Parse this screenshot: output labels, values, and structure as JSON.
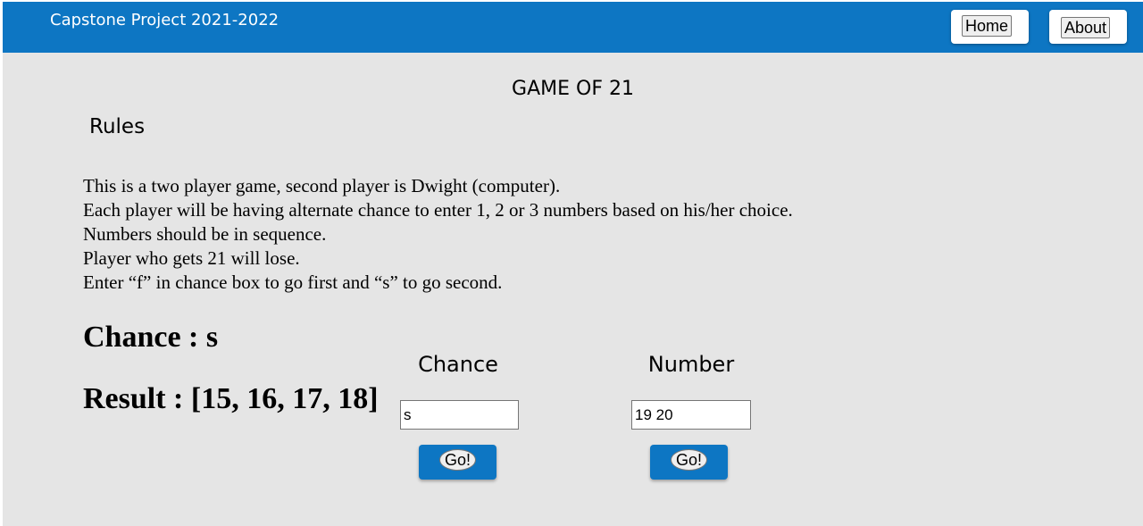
{
  "navbar": {
    "brand": "Capstone Project 2021-2022",
    "home_label": "Home",
    "about_label": "About"
  },
  "colors": {
    "navbar_bg": "#0d76c3",
    "page_bg": "#e5e5e5",
    "button_box_bg": "#0d76c3"
  },
  "game": {
    "title": "GAME OF 21",
    "rules_heading": "Rules",
    "rules": [
      "This is a two player game, second player is Dwight (computer).",
      "Each player will be having alternate chance to enter 1, 2 or 3 numbers based on his/her choice.",
      "Numbers should be in sequence.",
      "Player who gets 21 will lose.",
      "Enter “f” in chance box to go first and “s” to go second."
    ],
    "chance_status": "Chance : s",
    "result_status": "Result : [15, 16, 17, 18]"
  },
  "form": {
    "chance_label": "Chance",
    "chance_value": "s",
    "chance_go_label": "Go!",
    "number_label": "Number",
    "number_value": "19 20",
    "number_go_label": "Go!"
  }
}
